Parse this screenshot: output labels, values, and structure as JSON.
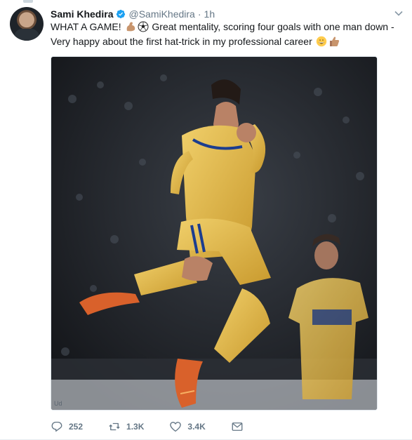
{
  "tweet": {
    "author_name": "Sami Khedira",
    "handle": "@SamiKhedira",
    "separator": "·",
    "time": "1h",
    "text_part1": "WHAT A GAME!",
    "text_part2": "Great mentality, scoring four goals with one man down -",
    "text_line2": "Very happy about the first hat-trick in my professional career",
    "image_watermark": "Ud"
  },
  "actions": {
    "replies": "252",
    "retweets": "1.3K",
    "likes": "3.4K"
  },
  "colors": {
    "verified": "#1da1f2",
    "secondary_text": "#657786",
    "kit_yellow": "#e8c35a"
  },
  "icons": [
    "verified-badge-icon",
    "flexed-biceps-icon",
    "soccer-ball-icon",
    "grinning-face-icon",
    "thumbs-up-icon",
    "reply-icon",
    "retweet-icon",
    "heart-icon",
    "direct-message-icon",
    "chevron-down-icon"
  ]
}
